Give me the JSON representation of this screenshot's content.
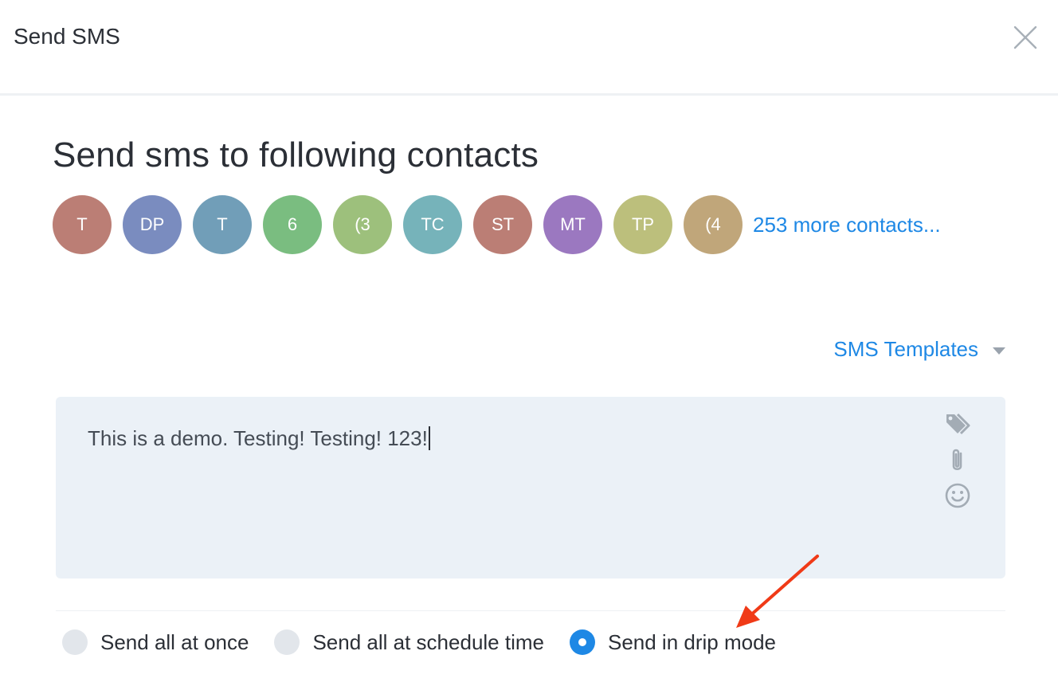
{
  "modal": {
    "title": "Send SMS"
  },
  "section": {
    "title": "Send sms to following contacts"
  },
  "contacts": {
    "avatars": [
      {
        "initials": "T",
        "color": "#bb7e75"
      },
      {
        "initials": "DP",
        "color": "#7a8cbf"
      },
      {
        "initials": "T",
        "color": "#719eb8"
      },
      {
        "initials": "6",
        "color": "#7abd80"
      },
      {
        "initials": "(3",
        "color": "#9dc07c"
      },
      {
        "initials": "TC",
        "color": "#76b3ba"
      },
      {
        "initials": "ST",
        "color": "#bb7e75"
      },
      {
        "initials": "MT",
        "color": "#9b78c0"
      },
      {
        "initials": "TP",
        "color": "#bcbf7c"
      },
      {
        "initials": "(4",
        "color": "#c0a67a"
      }
    ],
    "more_label": "253 more contacts..."
  },
  "templates": {
    "label": "SMS Templates"
  },
  "message": {
    "text": "This is a demo. Testing! Testing! 123!"
  },
  "tools": [
    "tag-icon",
    "paperclip-icon",
    "smiley-icon"
  ],
  "send_options": [
    {
      "label": "Send all at once",
      "selected": false
    },
    {
      "label": "Send all at schedule time",
      "selected": false
    },
    {
      "label": "Send in drip mode",
      "selected": true
    }
  ],
  "colors": {
    "accent": "#1e88e5",
    "annotation": "#f03a17",
    "message_bg": "#ebf1f7"
  }
}
